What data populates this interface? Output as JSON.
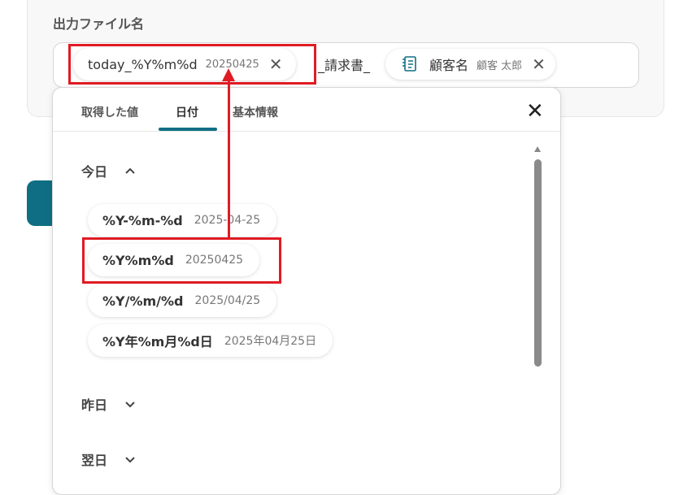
{
  "field": {
    "label": "出力ファイル名",
    "chip_today": {
      "main": "today_%Y%m%d",
      "sub": "20250425"
    },
    "separator": "_請求書_",
    "chip_name": {
      "main": "顧客名",
      "sub": "顧客 太郎",
      "icon": "document-icon"
    }
  },
  "popup": {
    "tabs": [
      {
        "label": "取得した値"
      },
      {
        "label": "日付"
      },
      {
        "label": "基本情報"
      }
    ],
    "active_tab": "日付",
    "close": "✕",
    "sections": {
      "today": {
        "label": "今日",
        "expanded": true,
        "options": [
          {
            "format": "%Y-%m-%d",
            "example": "2025-04-25"
          },
          {
            "format": "%Y%m%d",
            "example": "20250425"
          },
          {
            "format": "%Y/%m/%d",
            "example": "2025/04/25"
          },
          {
            "format": "%Y年%m月%d日",
            "example": "2025年04月25日"
          }
        ]
      },
      "yesterday": {
        "label": "昨日",
        "expanded": false
      },
      "tomorrow": {
        "label": "翌日",
        "expanded": false
      }
    }
  },
  "colors": {
    "accent": "#106e84",
    "highlight": "#e01b24"
  }
}
